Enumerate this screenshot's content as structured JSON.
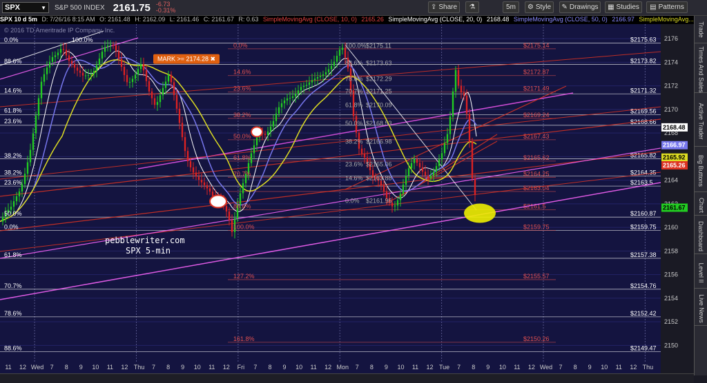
{
  "toolbar": {
    "symbol": "SPX",
    "index_name": "S&P 500 INDEX",
    "last_price": "2161.75",
    "change": "-6.73",
    "change_pct": "-0.31%",
    "share": "Share",
    "timeframe": "5m",
    "style": "Style",
    "drawings": "Drawings",
    "studies": "Studies",
    "patterns": "Patterns"
  },
  "infobar": {
    "symbol": "SPX 10 d 5m",
    "date": "D: 7/26/16 8:15 AM",
    "open": "O: 2161.48",
    "high": "H: 2162.09",
    "low": "L: 2161.46",
    "close": "C: 2161.67",
    "range": "R: 0.63",
    "sma10": "SimpleMovingAvg (CLOSE, 10, 0)",
    "sma10_val": "2165.26",
    "sma20": "SimpleMovingAvg (CLOSE, 20, 0)",
    "sma20_val": "2168.48",
    "sma50": "SimpleMovingAvg (CLOSE, 50, 0)",
    "sma50_val": "2166.97",
    "sma_more": "SimpleMovingAvg..."
  },
  "sidebar": [
    "Trade",
    "Times And Sales",
    "Active Trader",
    "Big Buttons",
    "Chart",
    "Dashboard",
    "Level II",
    "Live News"
  ],
  "chart_data": {
    "type": "candlestick",
    "y_range": [
      2148.5,
      2177
    ],
    "y_ticks": [
      2150,
      2152,
      2154,
      2156,
      2158,
      2160,
      2162,
      2164,
      2166,
      2168,
      2170,
      2172,
      2174,
      2176
    ],
    "x_labels": [
      "11",
      "12",
      "Wed",
      "7",
      "8",
      "9",
      "10",
      "11",
      "12",
      "Thu",
      "7",
      "8",
      "9",
      "10",
      "11",
      "12",
      "Fri",
      "7",
      "8",
      "9",
      "10",
      "11",
      "12",
      "Mon",
      "7",
      "8",
      "9",
      "10",
      "11",
      "12",
      "Tue",
      "7",
      "8",
      "9",
      "10",
      "11",
      "12",
      "Wed",
      "7",
      "8",
      "9",
      "10",
      "11",
      "12",
      "Thu"
    ],
    "session_separators": [
      "Wed",
      "Thu",
      "Fri",
      "Mon",
      "Tue",
      "Wed",
      "Thu"
    ],
    "watermark": "© 2016 TD Ameritrade IP Company, Inc.",
    "annotation_lines": [
      "pebblewriter.com",
      "SPX 5-min"
    ],
    "mark_label": "MARK >= 2174.28",
    "mark_value": 2174.28,
    "price_levels": [
      {
        "price": 2175.63,
        "label": "$2175.63",
        "color": "#ffffff"
      },
      {
        "price": 2173.82,
        "label": "$2173.82",
        "color": "#ffffff"
      },
      {
        "price": 2171.32,
        "label": "$2171.32",
        "color": "#ffffff"
      },
      {
        "price": 2169.56,
        "label": "$2169.56",
        "color": "#ffffff"
      },
      {
        "price": 2168.66,
        "label": "$2168.66",
        "color": "#ffffff"
      },
      {
        "price": 2165.82,
        "label": "$2165.82",
        "color": "#ffffff"
      },
      {
        "price": 2164.35,
        "label": "$2164.35",
        "color": "#ffffff"
      },
      {
        "price": 2163.5,
        "label": "$2163.5",
        "color": "#ffffff"
      },
      {
        "price": 2160.87,
        "label": "$2160.87",
        "color": "#ffffff"
      },
      {
        "price": 2159.75,
        "label": "$2159.75",
        "color": "#ffffff"
      },
      {
        "price": 2157.38,
        "label": "$2157.38",
        "color": "#ffffff"
      },
      {
        "price": 2154.76,
        "label": "$2154.76",
        "color": "#ffffff"
      },
      {
        "price": 2152.42,
        "label": "$2152.42",
        "color": "#ffffff"
      },
      {
        "price": 2149.47,
        "label": "$2149.47",
        "color": "#ffffff"
      },
      {
        "price": 2175.14,
        "label": "$2175.14",
        "color": "#e05050"
      },
      {
        "price": 2172.87,
        "label": "$2172.87",
        "color": "#e05050"
      },
      {
        "price": 2171.49,
        "label": "$2171.49",
        "color": "#e05050"
      },
      {
        "price": 2169.24,
        "label": "$2169.24",
        "color": "#e05050"
      },
      {
        "price": 2167.43,
        "label": "$2167.43",
        "color": "#e05050"
      },
      {
        "price": 2165.62,
        "label": "$2165.62",
        "color": "#e05050"
      },
      {
        "price": 2164.25,
        "label": "$2164.25",
        "color": "#e05050"
      },
      {
        "price": 2163.04,
        "label": "$2163.04",
        "color": "#e05050"
      },
      {
        "price": 2161.5,
        "label": "$2161.5",
        "color": "#e05050"
      },
      {
        "price": 2159.75,
        "label": "$2159.75",
        "color": "#e05050"
      },
      {
        "price": 2155.57,
        "label": "$2155.57",
        "color": "#e05050"
      },
      {
        "price": 2150.26,
        "label": "$2150.26",
        "color": "#e05050"
      }
    ],
    "fib_labels": [
      {
        "text": "0.0%",
        "price": 2175.6,
        "color": "#ffffff"
      },
      {
        "text": "100.0%",
        "price": 2175.6,
        "color": "#ffffff"
      },
      {
        "text": "88.6%",
        "price": 2173.8,
        "color": "#ffffff"
      },
      {
        "text": "14.6%",
        "price": 2171.3,
        "color": "#ffffff"
      },
      {
        "text": "61.8%",
        "price": 2169.6,
        "color": "#ffffff"
      },
      {
        "text": "23.6%",
        "price": 2168.7,
        "color": "#ffffff"
      },
      {
        "text": "38.2%",
        "price": 2165.8,
        "color": "#ffffff"
      },
      {
        "text": "38.2%",
        "price": 2164.35,
        "color": "#ffffff"
      },
      {
        "text": "23.6%",
        "price": 2163.5,
        "color": "#ffffff"
      },
      {
        "text": "50.0%",
        "price": 2160.87,
        "color": "#ffffff"
      },
      {
        "text": "0.0%",
        "price": 2159.75,
        "color": "#ffffff"
      },
      {
        "text": "61.8%",
        "price": 2157.38,
        "color": "#ffffff"
      },
      {
        "text": "70.7%",
        "price": 2154.76,
        "color": "#ffffff"
      },
      {
        "text": "78.6%",
        "price": 2152.42,
        "color": "#ffffff"
      },
      {
        "text": "88.6%",
        "price": 2149.47,
        "color": "#ffffff"
      },
      {
        "text": "0.0%",
        "price": 2175.14,
        "color": "#e05050"
      },
      {
        "text": "14.6%",
        "price": 2172.87,
        "color": "#e05050"
      },
      {
        "text": "23.6%",
        "price": 2171.49,
        "color": "#e05050"
      },
      {
        "text": "38.2%",
        "price": 2169.24,
        "color": "#e05050"
      },
      {
        "text": "50.0%",
        "price": 2167.43,
        "color": "#e05050"
      },
      {
        "text": "61.8%",
        "price": 2165.62,
        "color": "#e05050"
      },
      {
        "text": "70.7%",
        "price": 2164.25,
        "color": "#e05050"
      },
      {
        "text": "88.6%",
        "price": 2161.5,
        "color": "#e05050"
      },
      {
        "text": "100.0%",
        "price": 2159.75,
        "color": "#e05050"
      },
      {
        "text": "127.2%",
        "price": 2155.57,
        "color": "#e05050"
      },
      {
        "text": "161.8%",
        "price": 2150.26,
        "color": "#e05050"
      },
      {
        "text": "100.0%",
        "price": 2175.11,
        "color": "#aaaaaa"
      },
      {
        "text": "88.6%",
        "price": 2173.63,
        "color": "#aaaaaa"
      },
      {
        "text": "78.6%",
        "price": 2172.29,
        "color": "#aaaaaa"
      },
      {
        "text": "70.7%",
        "price": 2171.25,
        "color": "#aaaaaa"
      },
      {
        "text": "61.8%",
        "price": 2170.09,
        "color": "#aaaaaa"
      },
      {
        "text": "50.0%",
        "price": 2168.53,
        "color": "#aaaaaa"
      },
      {
        "text": "38.2%",
        "price": 2166.98,
        "color": "#aaaaaa"
      },
      {
        "text": "23.6%",
        "price": 2165.06,
        "color": "#aaaaaa"
      },
      {
        "text": "14.6%",
        "price": 2163.88,
        "color": "#aaaaaa"
      },
      {
        "text": "0.0%",
        "price": 2161.96,
        "color": "#aaaaaa"
      }
    ],
    "fib_values": [
      "$2175.11",
      "$2173.63",
      "$2172.29",
      "$2171.25",
      "$2170.09",
      "$2168.53",
      "$2166.98",
      "$2165.06",
      "$2163.88",
      "$2161.96"
    ],
    "axis_badges": [
      {
        "price": 2168.48,
        "label": "2168.48",
        "bg": "#ffffff",
        "fg": "#000000"
      },
      {
        "price": 2166.97,
        "label": "2166.97",
        "bg": "#7777ee",
        "fg": "#ffffff"
      },
      {
        "price": 2165.92,
        "label": "2165.92",
        "bg": "#dddd22",
        "fg": "#000000"
      },
      {
        "price": 2165.26,
        "label": "2165.26",
        "bg": "#dd3322",
        "fg": "#ffffff"
      },
      {
        "price": 2161.67,
        "label": "2161.67",
        "bg": "#22cc22",
        "fg": "#000000"
      }
    ],
    "price_path": [
      [
        0,
        2160.5
      ],
      [
        15,
        2161.3
      ],
      [
        30,
        2163.5
      ],
      [
        45,
        2167
      ],
      [
        60,
        2172
      ],
      [
        75,
        2174.5
      ],
      [
        90,
        2175.6
      ],
      [
        100,
        2174
      ],
      [
        110,
        2173
      ],
      [
        120,
        2172.8
      ],
      [
        135,
        2173.5
      ],
      [
        150,
        2175
      ],
      [
        165,
        2175.2
      ],
      [
        175,
        2174
      ],
      [
        185,
        2172.5
      ],
      [
        195,
        2172.8
      ],
      [
        205,
        2173.6
      ],
      [
        215,
        2171.5
      ],
      [
        225,
        2170.5
      ],
      [
        235,
        2172
      ],
      [
        245,
        2173
      ],
      [
        255,
        2170
      ],
      [
        262,
        2168
      ],
      [
        270,
        2166
      ],
      [
        280,
        2165
      ],
      [
        290,
        2164
      ],
      [
        300,
        2163
      ],
      [
        310,
        2162.2
      ],
      [
        320,
        2162.5
      ],
      [
        330,
        2161.5
      ],
      [
        336,
        2159.8
      ],
      [
        345,
        2162
      ],
      [
        355,
        2164
      ],
      [
        365,
        2166.5
      ],
      [
        375,
        2168.5
      ],
      [
        385,
        2168
      ],
      [
        395,
        2168.6
      ],
      [
        405,
        2170
      ],
      [
        415,
        2171
      ],
      [
        425,
        2171.5
      ],
      [
        435,
        2172
      ],
      [
        445,
        2171.8
      ],
      [
        455,
        2172.3
      ],
      [
        465,
        2173
      ],
      [
        475,
        2173.7
      ],
      [
        485,
        2174.2
      ],
      [
        495,
        2175.1
      ],
      [
        505,
        2173
      ],
      [
        512,
        2169.5
      ],
      [
        520,
        2167
      ],
      [
        530,
        2166
      ],
      [
        540,
        2164
      ],
      [
        550,
        2163.5
      ],
      [
        560,
        2162.5
      ],
      [
        570,
        2162
      ],
      [
        580,
        2163
      ],
      [
        590,
        2164.5
      ],
      [
        600,
        2165.5
      ],
      [
        610,
        2165
      ],
      [
        620,
        2164.5
      ],
      [
        630,
        2165
      ],
      [
        640,
        2166
      ],
      [
        650,
        2168
      ],
      [
        655,
        2171
      ],
      [
        660,
        2173.5
      ],
      [
        665,
        2172
      ],
      [
        672,
        2171.5
      ],
      [
        678,
        2169
      ],
      [
        684,
        2164
      ],
      [
        690,
        2161.7
      ]
    ]
  }
}
